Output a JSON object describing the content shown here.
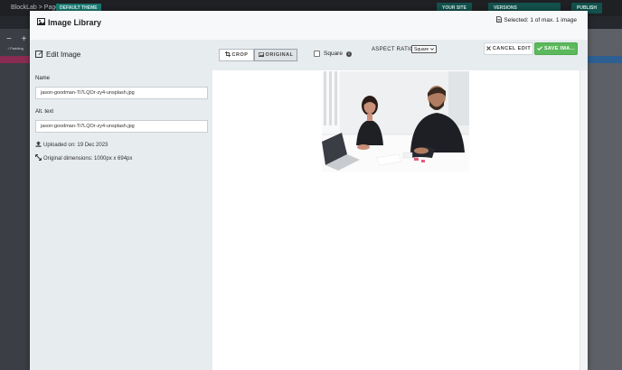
{
  "background": {
    "brand": "BlockLab > Page",
    "badge": "DEFAULT THEME",
    "your_site": "YOUR SITE",
    "versions": "VERSIONS",
    "publish": "PUBLISH",
    "side_controls": "− +",
    "side_label": "↕ Padding"
  },
  "modal": {
    "title": "Image Library",
    "selected": "Selected: 1 of max. 1 image"
  },
  "edit_panel": {
    "title": "Edit Image",
    "name_label": "Name",
    "name_value": "jason-goodman-Ti7LQOr-zy4-unsplash.jpg",
    "alt_label": "Alt. text",
    "alt_value": "jason-goodman-Ti7LQOr-zy4-unsplash.jpg",
    "uploaded": "Uploaded on: 19 Dec 2023",
    "dimensions": "Original dimensions: 1000px x 694px"
  },
  "toolbar": {
    "crop_label": "CROP",
    "original_label": "ORIGINAL",
    "square_label": "Square",
    "aspect_ratio_label": "ASPECT RATIO",
    "aspect_ratio_value": "Square",
    "cancel_label": "CANCEL EDIT",
    "save_label": "SAVE IMA..."
  },
  "colors": {
    "accent_green": "#5cb85c",
    "teal": "#1a7a72",
    "panel_bg": "#e7ecee"
  },
  "icons": {
    "title_icon": "image-icon",
    "selected_icon": "file-icon",
    "edit_icon": "edit-icon",
    "upload_icon": "upload-icon",
    "dimensions_icon": "expand-icon",
    "crop_icon": "crop-icon",
    "original_icon": "image-icon",
    "info_icon": "info-icon",
    "cancel_icon": "close-icon",
    "save_icon": "check-icon"
  }
}
